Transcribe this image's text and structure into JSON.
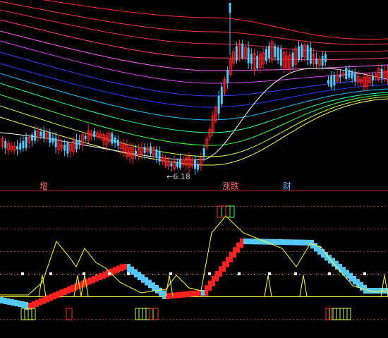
{
  "colors": {
    "background": "#000000",
    "up_candle": "#ff2020",
    "down_candle": "#54c8ff",
    "divider": "#cc2020",
    "grid": "#993333",
    "accent_yellow": "#ffff30"
  },
  "price_panel": {
    "low_marker": "←6.18"
  },
  "labels": {
    "a": "增",
    "b": "涨跌",
    "c": "财"
  },
  "label_colors": {
    "a": "#ff6a6a",
    "b": "#ff6a6a",
    "c": "#6ab4ff"
  }
}
